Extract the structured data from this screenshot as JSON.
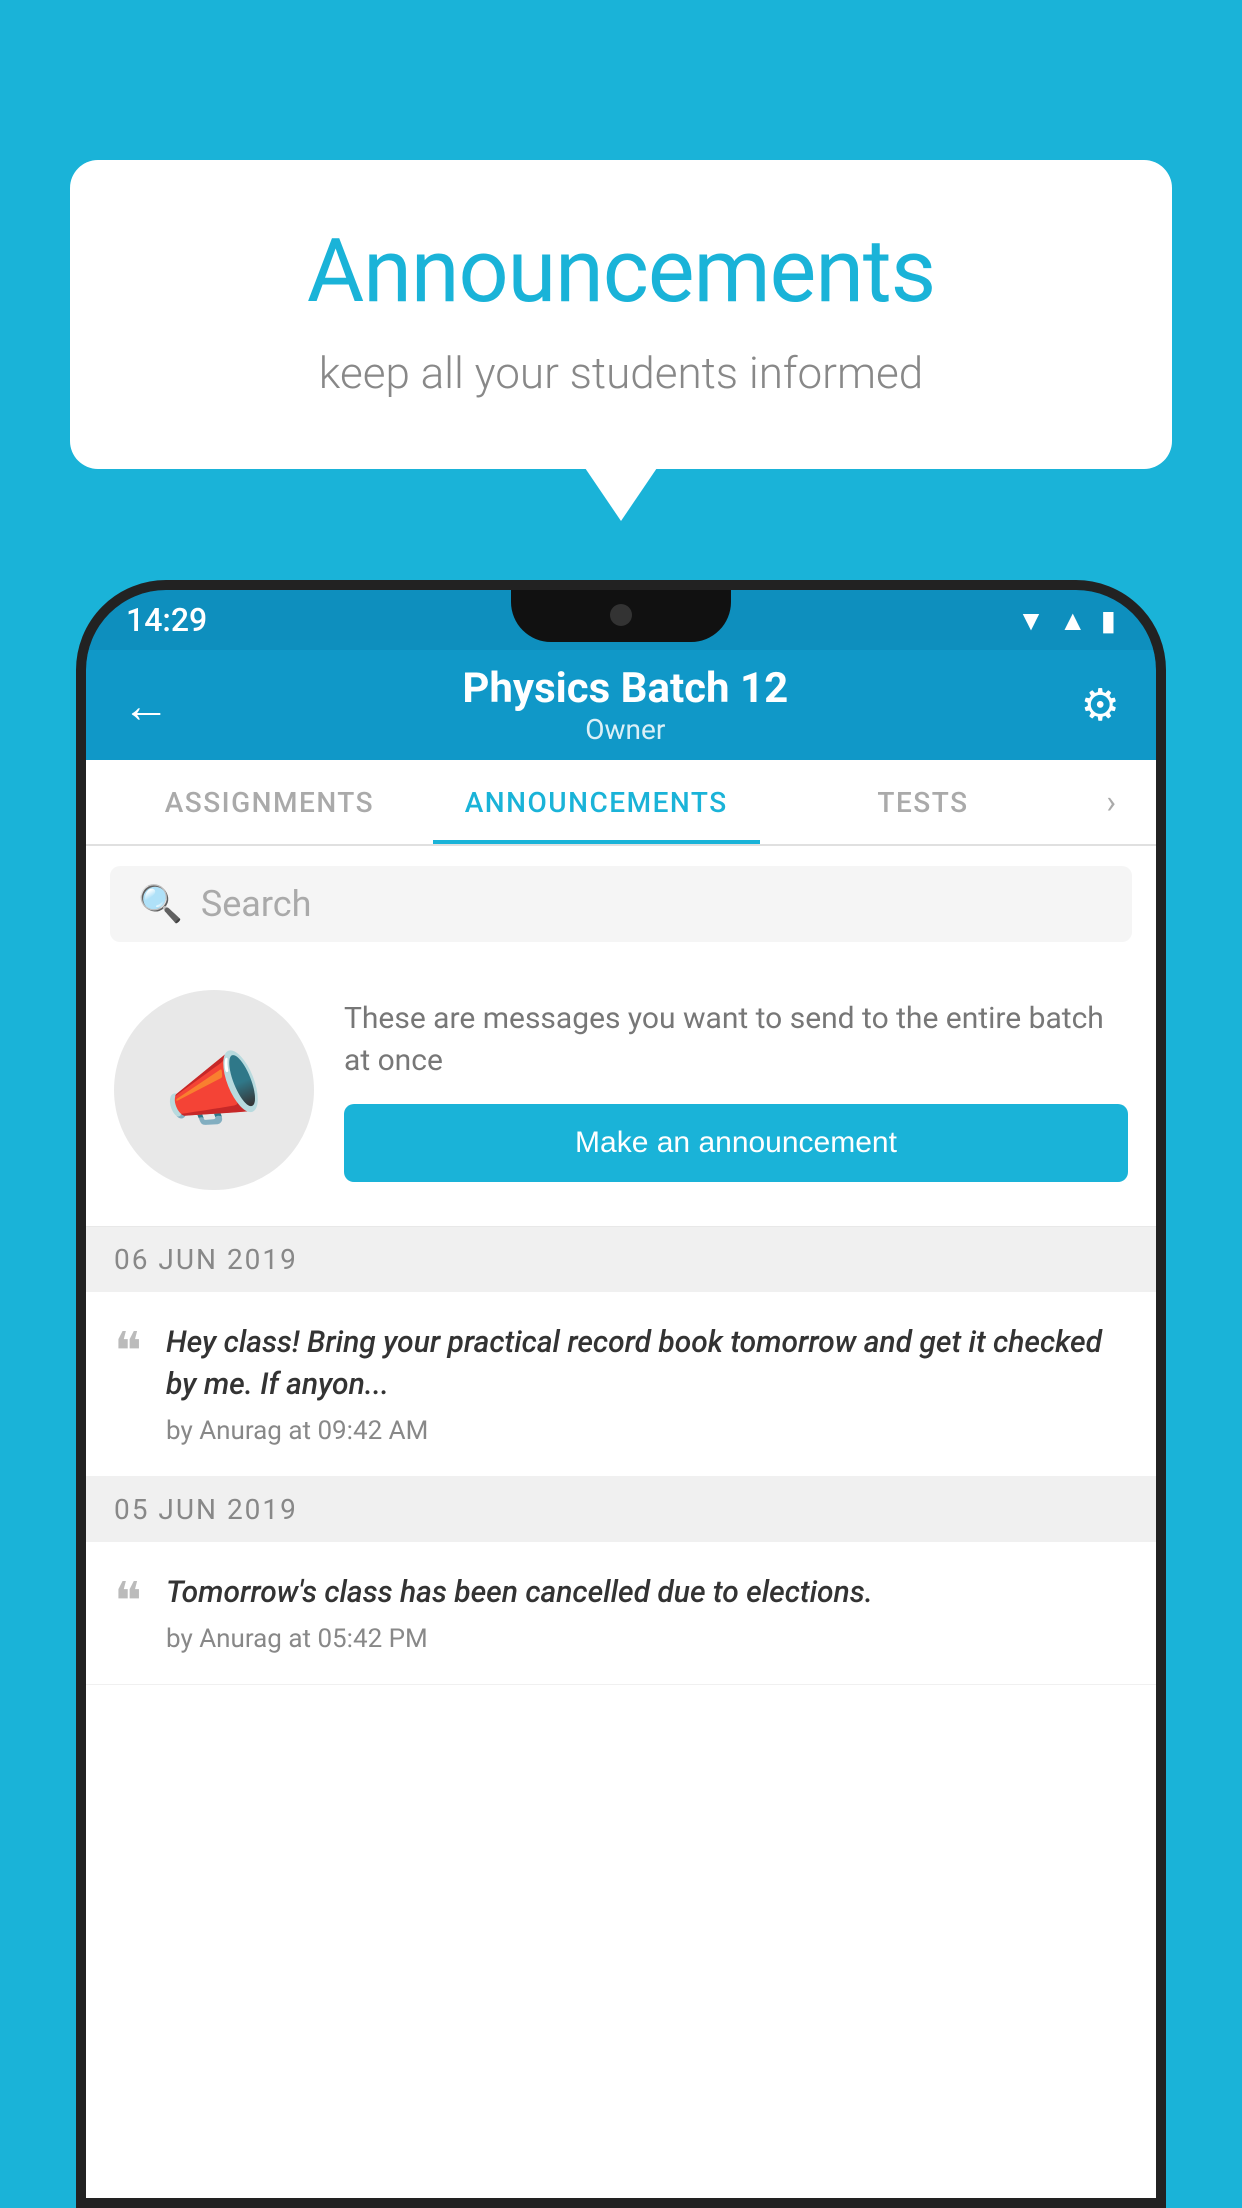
{
  "background_color": "#1ab3d8",
  "bubble": {
    "title": "Announcements",
    "subtitle": "keep all your students informed"
  },
  "phone": {
    "status_bar": {
      "time": "14:29"
    },
    "header": {
      "title": "Physics Batch 12",
      "subtitle": "Owner",
      "back_label": "←",
      "gear_label": "⚙"
    },
    "tabs": [
      {
        "label": "ASSIGNMENTS",
        "active": false
      },
      {
        "label": "ANNOUNCEMENTS",
        "active": true
      },
      {
        "label": "TESTS",
        "active": false
      }
    ],
    "tab_more": "›",
    "search": {
      "placeholder": "Search"
    },
    "promo": {
      "description": "These are messages you want to send to the entire batch at once",
      "button_label": "Make an announcement"
    },
    "announcements": [
      {
        "date": "06  JUN  2019",
        "text": "Hey class! Bring your practical record book tomorrow and get it checked by me. If anyon...",
        "meta": "by Anurag at 09:42 AM"
      },
      {
        "date": "05  JUN  2019",
        "text": "Tomorrow's class has been cancelled due to elections.",
        "meta": "by Anurag at 05:42 PM"
      }
    ]
  }
}
